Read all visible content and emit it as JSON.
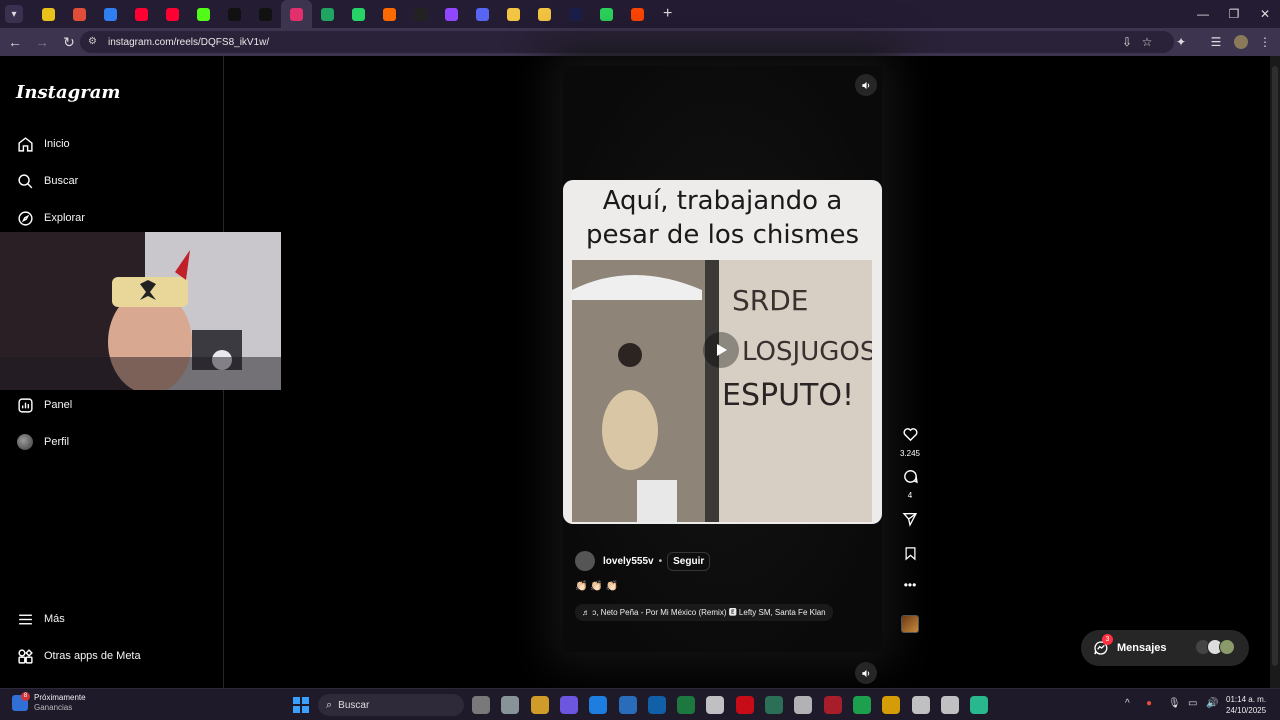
{
  "browser": {
    "url": "instagram.com/reels/DQFS8_ikV1w/",
    "tabs": [
      {
        "icon": "tab-favicon-yellow",
        "color": "#e8c21a"
      },
      {
        "icon": "tab-favicon-red",
        "color": "#e04e39"
      },
      {
        "icon": "tab-favicon-blue",
        "color": "#2f7ff0"
      },
      {
        "icon": "tab-favicon-youtube",
        "color": "#ff0033"
      },
      {
        "icon": "tab-favicon-youtube",
        "color": "#ff0033"
      },
      {
        "icon": "tab-favicon-kick",
        "color": "#53fc18"
      },
      {
        "icon": "tab-favicon-tiktok",
        "color": "#111111"
      },
      {
        "icon": "tab-favicon-tiktok",
        "color": "#111111"
      },
      {
        "icon": "tab-favicon-instagram",
        "color": "#e1306c"
      },
      {
        "icon": "tab-favicon-drive",
        "color": "#1fa463"
      },
      {
        "icon": "tab-favicon-whatsapp",
        "color": "#25d366"
      },
      {
        "icon": "tab-favicon-u",
        "color": "#ff6a00"
      },
      {
        "icon": "tab-favicon-x",
        "color": "#222222"
      },
      {
        "icon": "tab-favicon-twitch",
        "color": "#9146ff"
      },
      {
        "icon": "tab-favicon-hex",
        "color": "#5865f2"
      },
      {
        "icon": "tab-favicon-gemini",
        "color": "#f4c542"
      },
      {
        "icon": "tab-favicon-gemini",
        "color": "#f4c542"
      },
      {
        "icon": "tab-favicon-dark",
        "color": "#1a1f4a"
      },
      {
        "icon": "tab-favicon-green",
        "color": "#2bd45b"
      },
      {
        "icon": "tab-favicon-reddit",
        "color": "#ff4500"
      }
    ],
    "active_tab_index": 8
  },
  "sidebar": {
    "logo": "Instagram",
    "items": [
      {
        "label": "Inicio",
        "icon": "home-icon"
      },
      {
        "label": "Buscar",
        "icon": "search-icon"
      },
      {
        "label": "Explorar",
        "icon": "compass-icon"
      },
      {
        "label": "Panel",
        "icon": "bar-chart-icon"
      },
      {
        "label": "Perfil",
        "icon": "profile-avatar-icon"
      },
      {
        "label": "Más",
        "icon": "menu-icon"
      },
      {
        "label": "Otras apps de Meta",
        "icon": "meta-apps-icon"
      }
    ]
  },
  "reel": {
    "caption_line1": "Aquí, trabajando a",
    "caption_line2": "pesar de los chismes",
    "author": "lovely555v",
    "separator": "•",
    "follow_label": "Seguir",
    "emoji_text": "👏🏻 👏🏻 👏🏻",
    "audio_text": "♬ ɔ, Neto Peña - Por Mi México (Remix) 🅴 Lefty SM, Santa Fe Klan",
    "likes": "3.245",
    "comments": "4"
  },
  "messages": {
    "label": "Mensajes",
    "badge": "3"
  },
  "taskbar": {
    "widget_line1": "Próximamente",
    "widget_line2": "Ganancias",
    "widget_badge": "8",
    "search_label": "Buscar",
    "time": "01:14 a. m.",
    "date": "24/10/2025"
  }
}
